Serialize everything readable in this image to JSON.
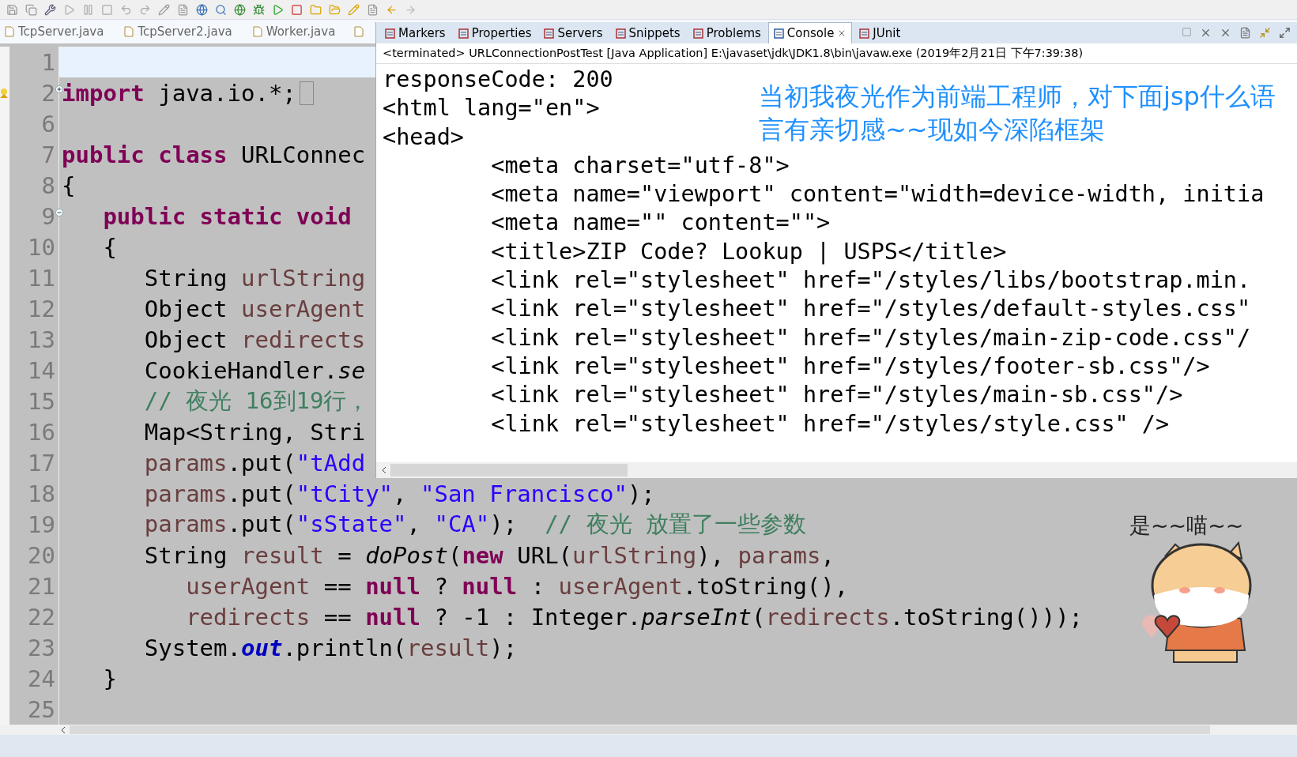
{
  "editor": {
    "tabs": [
      {
        "label": "TcpServer.java",
        "selected": false
      },
      {
        "label": "TcpServer2.java",
        "selected": false
      },
      {
        "label": "Worker.java",
        "selected": false
      }
    ],
    "lines": [
      {
        "number": "1",
        "current": true,
        "warning": false
      },
      {
        "number": "2",
        "current": false,
        "warning": true,
        "fold_marker": {
          "expanded": false
        },
        "tokens": [
          {
            "kind": "keyword",
            "text": "import"
          },
          {
            "kind": "plain",
            "text": " java.io.*;"
          }
        ]
      },
      {
        "number": "6",
        "current": false,
        "warning": false
      },
      {
        "number": "7",
        "current": false,
        "warning": false,
        "tokens": [
          {
            "kind": "keyword",
            "text": "public"
          },
          {
            "kind": "keyword",
            "text": " class"
          },
          {
            "kind": "plain",
            "text": " URLConnec"
          }
        ]
      },
      {
        "number": "8",
        "current": false,
        "warning": false,
        "tokens": [
          {
            "kind": "plain",
            "text": "{"
          }
        ]
      },
      {
        "number": "9",
        "current": false,
        "warning": false,
        "fold_marker": {
          "expanded": true
        },
        "tokens": [
          {
            "kind": "keyword",
            "text": "   public"
          },
          {
            "kind": "keyword",
            "text": " static"
          },
          {
            "kind": "keyword",
            "text": " void"
          }
        ]
      },
      {
        "number": "10",
        "current": false,
        "warning": false,
        "tokens": [
          {
            "kind": "plain",
            "text": "   {"
          }
        ]
      },
      {
        "number": "11",
        "current": false,
        "warning": false,
        "tokens": [
          {
            "kind": "plain",
            "text": "      String "
          },
          {
            "kind": "variable",
            "text": "urlString"
          }
        ]
      },
      {
        "number": "12",
        "current": false,
        "warning": false,
        "tokens": [
          {
            "kind": "plain",
            "text": "      Object "
          },
          {
            "kind": "variable",
            "text": "userAgent"
          }
        ]
      },
      {
        "number": "13",
        "current": false,
        "warning": false,
        "tokens": [
          {
            "kind": "plain",
            "text": "      Object "
          },
          {
            "kind": "variable",
            "text": "redirects"
          }
        ]
      },
      {
        "number": "14",
        "current": false,
        "warning": false,
        "tokens": [
          {
            "kind": "plain",
            "text": "      CookieHandler."
          },
          {
            "kind": "method",
            "text": "se"
          }
        ]
      },
      {
        "number": "15",
        "current": false,
        "warning": false,
        "tokens": [
          {
            "kind": "comment",
            "text": "      // 夜光 16到19行，"
          }
        ]
      },
      {
        "number": "16",
        "current": false,
        "warning": false,
        "tokens": [
          {
            "kind": "plain",
            "text": "      Map<String, Stri"
          }
        ]
      },
      {
        "number": "17",
        "current": false,
        "warning": false,
        "tokens": [
          {
            "kind": "variable",
            "text": "      params"
          },
          {
            "kind": "plain",
            "text": ".put("
          },
          {
            "kind": "string",
            "text": "\"tAdd"
          }
        ]
      },
      {
        "number": "18",
        "current": false,
        "warning": false,
        "tokens": [
          {
            "kind": "variable",
            "text": "      params"
          },
          {
            "kind": "plain",
            "text": ".put("
          },
          {
            "kind": "string",
            "text": "\"tCity\""
          },
          {
            "kind": "plain",
            "text": ", "
          },
          {
            "kind": "string",
            "text": "\"San Francisco\""
          },
          {
            "kind": "plain",
            "text": ");"
          }
        ]
      },
      {
        "number": "19",
        "current": false,
        "warning": false,
        "tokens": [
          {
            "kind": "variable",
            "text": "      params"
          },
          {
            "kind": "plain",
            "text": ".put("
          },
          {
            "kind": "string",
            "text": "\"sState\""
          },
          {
            "kind": "plain",
            "text": ", "
          },
          {
            "kind": "string",
            "text": "\"CA\""
          },
          {
            "kind": "plain",
            "text": ");  "
          },
          {
            "kind": "comment",
            "text": "// 夜光 放置了一些参数"
          }
        ]
      },
      {
        "number": "20",
        "current": false,
        "warning": false,
        "tokens": [
          {
            "kind": "plain",
            "text": "      String "
          },
          {
            "kind": "variable",
            "text": "result"
          },
          {
            "kind": "plain",
            "text": " = "
          },
          {
            "kind": "method",
            "text": "doPost"
          },
          {
            "kind": "plain",
            "text": "("
          },
          {
            "kind": "keyword",
            "text": "new"
          },
          {
            "kind": "plain",
            "text": " URL("
          },
          {
            "kind": "variable",
            "text": "urlString"
          },
          {
            "kind": "plain",
            "text": "), "
          },
          {
            "kind": "variable",
            "text": "params"
          },
          {
            "kind": "plain",
            "text": ","
          }
        ]
      },
      {
        "number": "21",
        "current": false,
        "warning": false,
        "tokens": [
          {
            "kind": "variable",
            "text": "         userAgent"
          },
          {
            "kind": "plain",
            "text": " == "
          },
          {
            "kind": "keyword",
            "text": "null"
          },
          {
            "kind": "plain",
            "text": " ? "
          },
          {
            "kind": "keyword",
            "text": "null"
          },
          {
            "kind": "plain",
            "text": " : "
          },
          {
            "kind": "variable",
            "text": "userAgent"
          },
          {
            "kind": "plain",
            "text": ".toString(),"
          }
        ]
      },
      {
        "number": "22",
        "current": false,
        "warning": false,
        "tokens": [
          {
            "kind": "variable",
            "text": "         redirects"
          },
          {
            "kind": "plain",
            "text": " == "
          },
          {
            "kind": "keyword",
            "text": "null"
          },
          {
            "kind": "plain",
            "text": " ? -1 : Integer."
          },
          {
            "kind": "method",
            "text": "parseInt"
          },
          {
            "kind": "plain",
            "text": "("
          },
          {
            "kind": "variable",
            "text": "redirects"
          },
          {
            "kind": "plain",
            "text": ".toString()));"
          }
        ]
      },
      {
        "number": "23",
        "current": false,
        "warning": false,
        "tokens": [
          {
            "kind": "plain",
            "text": "      System."
          },
          {
            "kind": "static_field",
            "text": "out"
          },
          {
            "kind": "plain",
            "text": ".println("
          },
          {
            "kind": "variable",
            "text": "result"
          },
          {
            "kind": "plain",
            "text": ");"
          }
        ]
      },
      {
        "number": "24",
        "current": false,
        "warning": false,
        "tokens": [
          {
            "kind": "plain",
            "text": "   }"
          }
        ]
      },
      {
        "number": "25",
        "current": false,
        "warning": false
      }
    ]
  },
  "console": {
    "tabs": [
      {
        "label": "Markers",
        "selected": false
      },
      {
        "label": "Properties",
        "selected": false
      },
      {
        "label": "Servers",
        "selected": false
      },
      {
        "label": "Snippets",
        "selected": false
      },
      {
        "label": "Problems",
        "selected": false
      },
      {
        "label": "Console",
        "selected": true
      },
      {
        "label": "JUnit",
        "selected": false
      }
    ],
    "status": "<terminated> URLConnectionPostTest [Java Application] E:\\javaset\\jdk\\JDK1.8\\bin\\javaw.exe (2019年2月21日 下午7:39:38)",
    "lines": [
      "responseCode: 200",
      "<html lang=\"en\">",
      "<head>",
      "        <meta charset=\"utf-8\">",
      "        <meta name=\"viewport\" content=\"width=device-width, initia",
      "        <meta name=\"\" content=\"\">",
      "        <title>ZIP Code? Lookup | USPS</title>",
      "        <link rel=\"stylesheet\" href=\"/styles/libs/bootstrap.min.",
      "        <link rel=\"stylesheet\" href=\"/styles/default-styles.css\"",
      "        <link rel=\"stylesheet\" href=\"/styles/main-zip-code.css\"/",
      "        <link rel=\"stylesheet\" href=\"/styles/footer-sb.css\"/>",
      "        <link rel=\"stylesheet\" href=\"/styles/main-sb.css\"/>",
      "        <link rel=\"stylesheet\" href=\"/styles/style.css\" />"
    ],
    "annotation": "当初我夜光作为前端工程师，对下面jsp什么语言有亲切感~~现如今深陷框架"
  },
  "sticker": {
    "caption": "是~~喵~~"
  }
}
